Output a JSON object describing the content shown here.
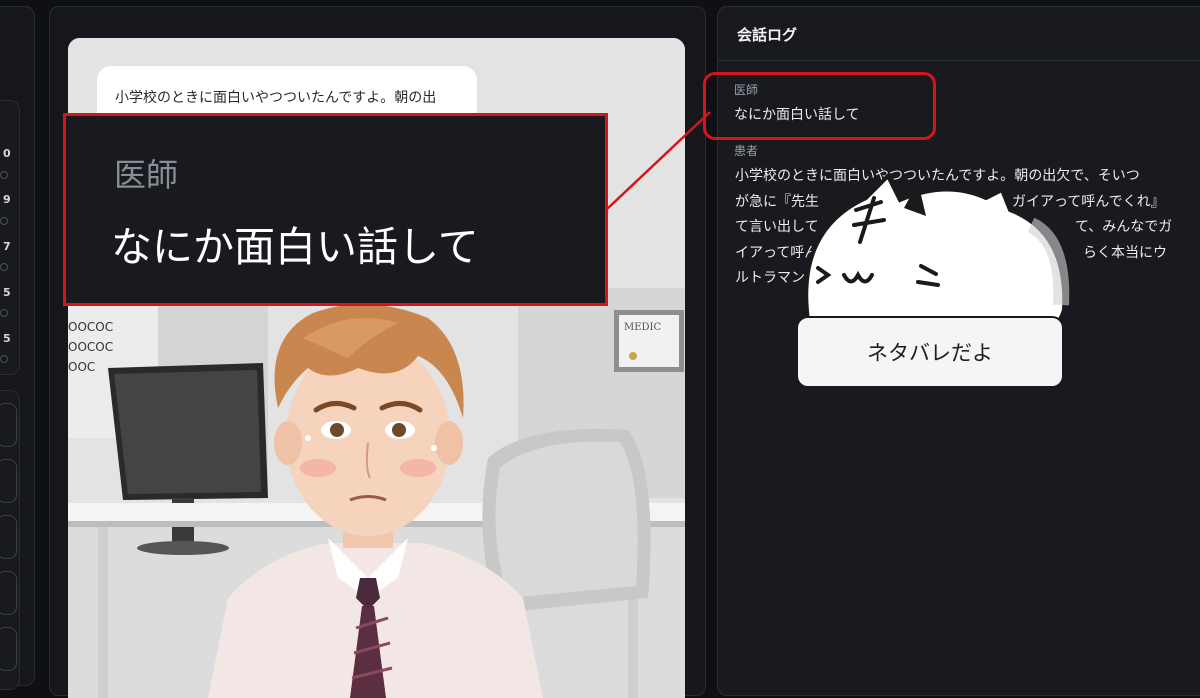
{
  "rail": {
    "numbers": [
      "0",
      "9",
      "7",
      "5",
      "5"
    ]
  },
  "scene": {
    "speech_bubble_text": "小学校のときに面白いやつついたんですよ。朝の出",
    "certificate_label": "MEDIC",
    "eye_chart_rows": [
      "OOCOC",
      "OOCOC",
      "OOC"
    ]
  },
  "callout": {
    "role": "医師",
    "message": "なにか面白い話して"
  },
  "conversation_log": {
    "title": "会話ログ",
    "entries": [
      {
        "role": "医師",
        "text": "なにか面白い話して"
      },
      {
        "role": "患者",
        "text": "小学校のときに面白いやつついたんですよ。朝の出欠で、そいつが急に『先生、僕のことガイアって呼んでくれ』って言い出して、先生もノリよく呼んでくれたから、みんなでガイアって呼んでたんです。そしたらしばらく本当にウルトラマンガイアみたいに…"
      }
    ],
    "patient_visible_lines": [
      "小学校のときに面白いやつついたんですよ。朝の出欠で、そいつ",
      "が急に『先生",
      "て言い出して",
      "イアって呼ん",
      "ルトラマンガ"
    ],
    "patient_line_tails": [
      "",
      "ガイアって呼んでくれ』っ",
      "て、みんなでガ",
      "らく本当にウ",
      ""
    ]
  },
  "overlay": {
    "spoiler_label": "ネタバレだよ",
    "mascot_icon": "cat-mascot-icon"
  },
  "colors": {
    "highlight": "#d8141b",
    "background": "#0e1015",
    "panel": "#181a20"
  }
}
